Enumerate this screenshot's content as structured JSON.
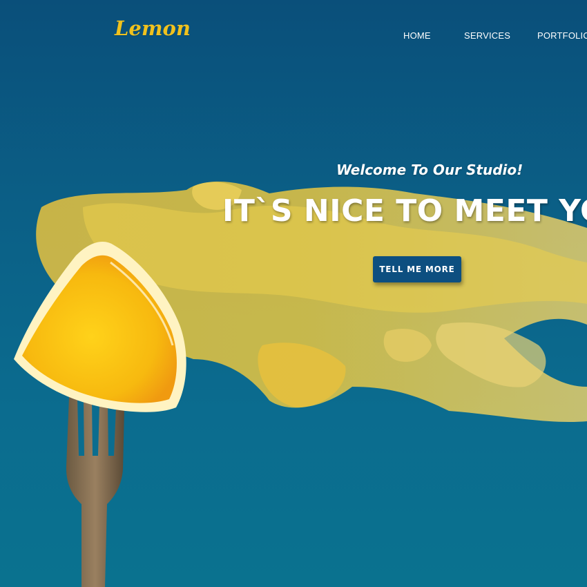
{
  "brand": {
    "logo_text": "Lemon",
    "accent_color": "#f0c21e"
  },
  "nav": {
    "items": [
      {
        "label": "HOME"
      },
      {
        "label": "SERVICES"
      },
      {
        "label": "PORTFOLIO"
      }
    ]
  },
  "hero": {
    "subtitle": "Welcome To Our Studio!",
    "headline": "IT`S NICE TO MEET YOU",
    "cta_label": "TELL ME MORE",
    "cta_color": "#0d4f80",
    "background_color": "#0b628a"
  }
}
